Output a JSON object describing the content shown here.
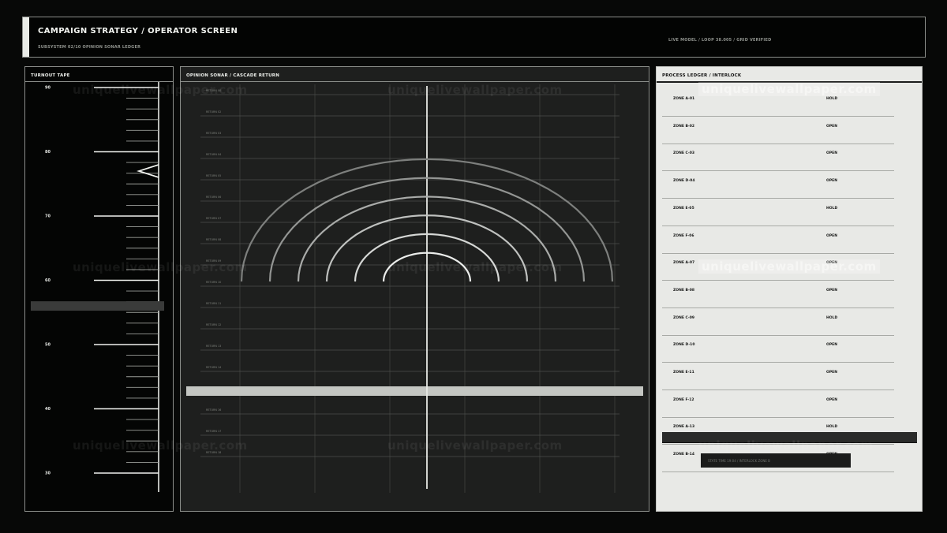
{
  "header": {
    "title": "CAMPAIGN STRATEGY / OPERATOR SCREEN",
    "subtitle": "SUBSYSTEM 02/10  OPINION SONAR LEDGER",
    "status": "LIVE MODEL / LOOP 38.005 / GRID VERIFIED"
  },
  "tape": {
    "title": "TURNOUT TAPE",
    "labels": [
      "90",
      "80",
      "70",
      "60",
      "50",
      "40",
      "30"
    ],
    "pointer_value": 77,
    "selection_value": 56
  },
  "sonar": {
    "title": "OPINION SONAR / CASCADE RETURN",
    "row_labels": [
      "RETURN 00",
      "RETURN 02",
      "RETURN 03",
      "RETURN 04",
      "RETURN 05",
      "RETURN 06",
      "RETURN 07",
      "RETURN 08",
      "RETURN 09",
      "RETURN 10",
      "RETURN 11",
      "RETURN 12",
      "RETURN 13",
      "RETURN 14",
      "RETURN 15",
      "RETURN 16",
      "RETURN 17",
      "RETURN 18"
    ],
    "arc_count": 6,
    "highlight_row": 14
  },
  "ledger": {
    "title": "PROCESS LEDGER / INTERLOCK",
    "rows": [
      {
        "zone": "ZONE A-01",
        "state": "HOLD"
      },
      {
        "zone": "ZONE B-02",
        "state": "OPEN"
      },
      {
        "zone": "ZONE C-03",
        "state": "OPEN"
      },
      {
        "zone": "ZONE D-04",
        "state": "OPEN"
      },
      {
        "zone": "ZONE E-05",
        "state": "HOLD"
      },
      {
        "zone": "ZONE F-06",
        "state": "OPEN"
      },
      {
        "zone": "ZONE A-07",
        "state": "OPEN"
      },
      {
        "zone": "ZONE B-08",
        "state": "OPEN"
      },
      {
        "zone": "ZONE C-09",
        "state": "HOLD"
      },
      {
        "zone": "ZONE D-10",
        "state": "OPEN"
      },
      {
        "zone": "ZONE E-11",
        "state": "OPEN"
      },
      {
        "zone": "ZONE F-12",
        "state": "OPEN"
      },
      {
        "zone": "ZONE A-13",
        "state": "HOLD"
      },
      {
        "zone": "ZONE B-14",
        "state": "OPEN"
      }
    ],
    "tooltip": "STATE TIME 19:04 / INTERLOCK ZONE B"
  },
  "watermark": "uniquelivewallpaper.com"
}
